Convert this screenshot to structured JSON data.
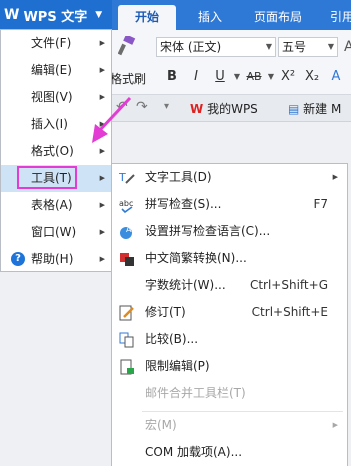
{
  "app": {
    "logo": "W",
    "name": "WPS 文字",
    "dropdown": "▼"
  },
  "ribbon": {
    "tabs": [
      "开始",
      "插入",
      "页面布局",
      "引用"
    ],
    "format_brush_label": "格式刷",
    "font_name": "宋体 (正文)",
    "font_size": "五号",
    "format_buttons": [
      "B",
      "I",
      "U",
      "AB",
      "X²",
      "X₂",
      "A"
    ]
  },
  "doc_tabs": {
    "tab1": "我的WPS",
    "tab2": "新建 M"
  },
  "menu": {
    "items": [
      {
        "label": "文件(F)"
      },
      {
        "label": "编辑(E)"
      },
      {
        "label": "视图(V)"
      },
      {
        "label": "插入(I)"
      },
      {
        "label": "格式(O)"
      },
      {
        "label": "工具(T)"
      },
      {
        "label": "表格(A)"
      },
      {
        "label": "窗口(W)"
      },
      {
        "label": "帮助(H)"
      }
    ],
    "submenu_arrow": "▶"
  },
  "submenu": {
    "items": [
      {
        "label": "文字工具(D)",
        "shortcut": "",
        "icon": "text-tools-icon"
      },
      {
        "label": "拼写检查(S)...",
        "shortcut": "F7",
        "icon": "spellcheck-icon"
      },
      {
        "label": "设置拼写检查语言(C)...",
        "shortcut": "",
        "icon": "spell-language-icon"
      },
      {
        "label": "中文简繁转换(N)...",
        "shortcut": "",
        "icon": "chinese-conversion-icon"
      },
      {
        "label": "字数统计(W)...",
        "shortcut": "Ctrl+Shift+G",
        "icon": ""
      },
      {
        "label": "修订(T)",
        "shortcut": "Ctrl+Shift+E",
        "icon": "revision-icon"
      },
      {
        "label": "比较(B)...",
        "shortcut": "",
        "icon": "compare-icon"
      },
      {
        "label": "限制编辑(P)",
        "shortcut": "",
        "icon": "restrict-edit-icon"
      },
      {
        "label": "邮件合并工具栏(T)",
        "shortcut": "",
        "icon": ""
      },
      {
        "label": "宏(M)",
        "shortcut": "",
        "icon": ""
      },
      {
        "label": "COM 加载项(A)...",
        "shortcut": "",
        "icon": ""
      }
    ]
  },
  "colors": {
    "accent": "#2f79d6",
    "highlight_box": "#e23cd4",
    "menu_highlight": "#cfe3f7"
  }
}
